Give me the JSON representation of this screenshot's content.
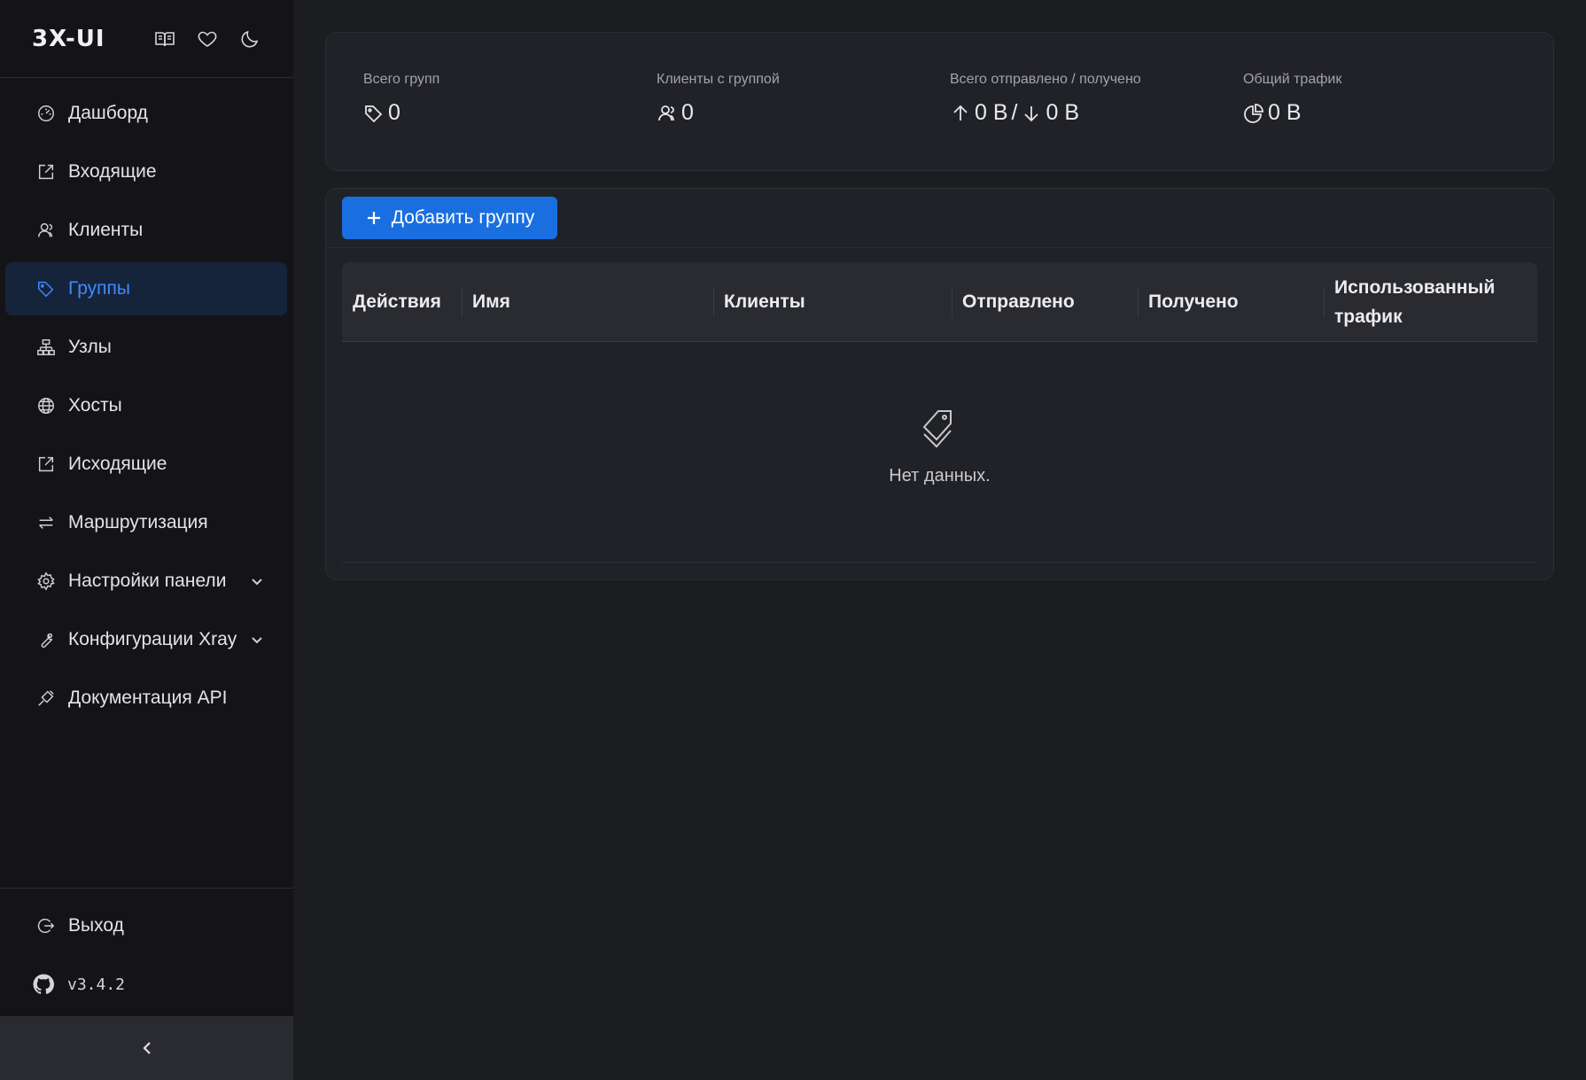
{
  "brand": {
    "title": "3X-UI"
  },
  "header_icons": [
    "book-icon",
    "heart-icon",
    "moon-icon"
  ],
  "nav": {
    "items": [
      {
        "label": "Дашборд",
        "icon": "dashboard-icon"
      },
      {
        "label": "Входящие",
        "icon": "inbound-icon"
      },
      {
        "label": "Клиенты",
        "icon": "users-icon"
      },
      {
        "label": "Группы",
        "icon": "tag-icon",
        "active": true
      },
      {
        "label": "Узлы",
        "icon": "nodes-icon"
      },
      {
        "label": "Хосты",
        "icon": "globe-icon"
      },
      {
        "label": "Исходящие",
        "icon": "outbound-icon"
      },
      {
        "label": "Маршрутизация",
        "icon": "swap-icon"
      },
      {
        "label": "Настройки панели",
        "icon": "gear-icon",
        "expandable": true
      },
      {
        "label": "Конфигурации Xray",
        "icon": "wrench-icon",
        "expandable": true
      },
      {
        "label": "Документация API",
        "icon": "api-icon"
      }
    ],
    "logout": "Выход",
    "version": "v3.4.2"
  },
  "stats": {
    "total_groups": {
      "label": "Всего групп",
      "value": "0"
    },
    "clients_with_group": {
      "label": "Клиенты с группой",
      "value": "0"
    },
    "sent_received": {
      "label": "Всего отправлено / получено",
      "sent": "0 B",
      "separator": "/",
      "received": "0 B"
    },
    "total_traffic": {
      "label": "Общий трафик",
      "value": "0 B"
    }
  },
  "groups": {
    "add_button": "Добавить группу",
    "columns": [
      "Действия",
      "Имя",
      "Клиенты",
      "Отправлено",
      "Получено",
      "Использованный трафик"
    ],
    "empty_text": "Нет данных."
  },
  "colors": {
    "accent": "#1a6fe0",
    "active_text": "#3d8bff",
    "background": "#1c1d21",
    "sidebar": "#141418"
  }
}
